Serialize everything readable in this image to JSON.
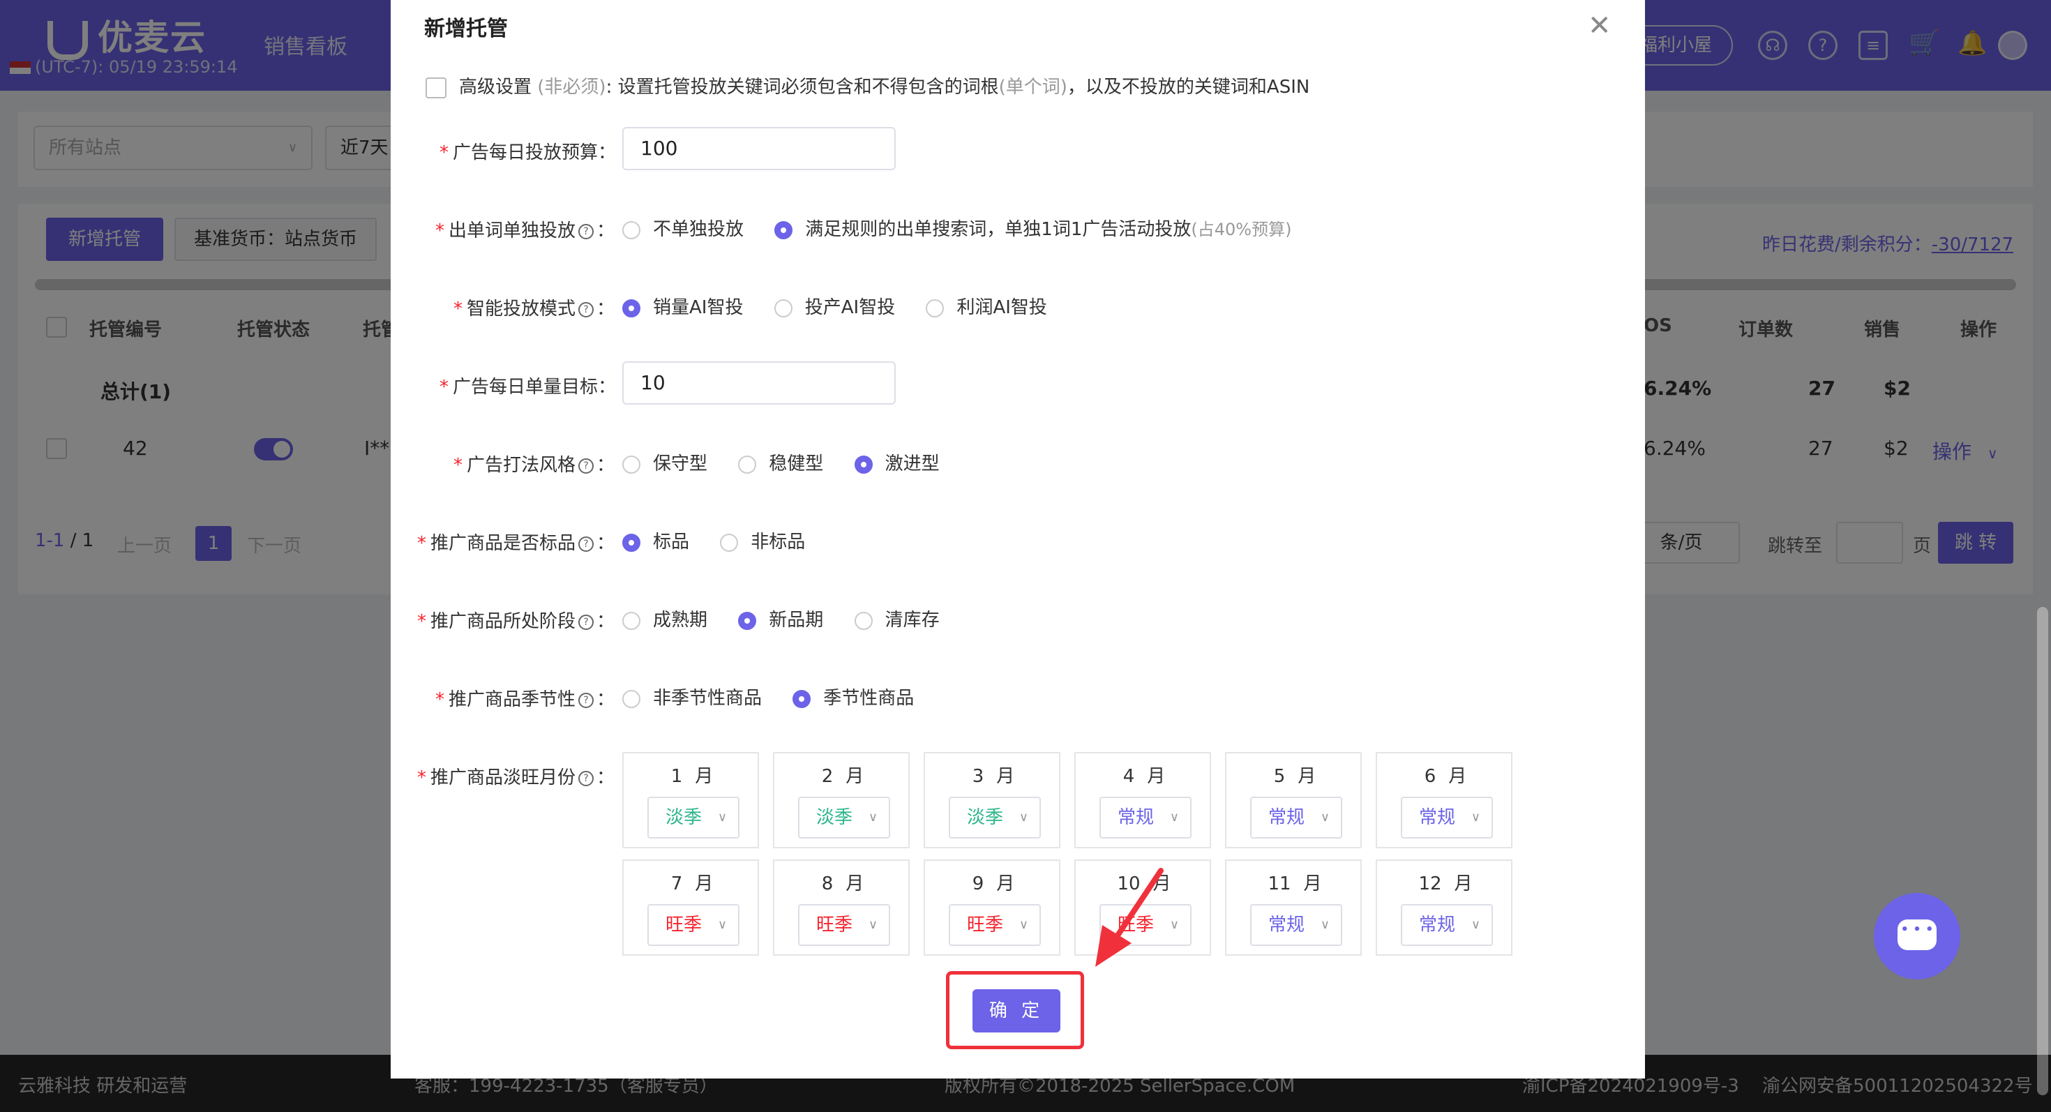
{
  "app": {
    "logo": "优麦云",
    "clock": "(UTC-7): 05/19 23:59:14",
    "nav_item": "销售看板",
    "welfare": "福利小屋"
  },
  "filters": {
    "site_placeholder": "所有站点",
    "date_range": "近7天"
  },
  "table": {
    "new_button": "新增托管",
    "currency_button": "基准货币：站点货币",
    "spend_info_label": "昨日花费/剩余积分：",
    "spend_info_value": "-30/7127",
    "headers": {
      "id": "托管编号",
      "status": "托管状态",
      "other": "托管",
      "acos": "OS",
      "orders": "订单数",
      "sales": "销售",
      "actions": "操作"
    },
    "total_row": {
      "label": "总计(1)",
      "acos": "6.24%",
      "orders": "27",
      "sales": "$2"
    },
    "rows": [
      {
        "id": "42",
        "name": "I**",
        "acos": "6.24%",
        "orders": "27",
        "sales": "$2",
        "action": "操作"
      }
    ],
    "pager": {
      "range": "1-1",
      "total": "/ 1",
      "prev": "上一页",
      "page": "1",
      "next": "下一页",
      "per_page": "条/页",
      "jump_to": "跳转至",
      "page_unit": "页",
      "go": "跳 转"
    }
  },
  "footer": {
    "company": "云雅科技 研发和运营",
    "service": "客服：199-4223-1735（客服专员）",
    "copyright": "版权所有©2018-2025 SellerSpace.COM",
    "icp": "渝ICP备2024021909号-3",
    "police": "渝公网安备50011202504322号"
  },
  "modal": {
    "title": "新增托管",
    "advanced": {
      "label": "高级设置",
      "optional": "(非必须)",
      "description": ": 设置托管投放关键词必须包含和不得包含的词根",
      "single_word": "(单个词)",
      "description2": "，以及不投放的关键词和ASIN"
    },
    "daily_budget": {
      "label": "广告每日投放预算",
      "value": "100"
    },
    "single_word_delivery": {
      "label": "出单词单独投放",
      "options": [
        "不单独投放",
        "满足规则的出单搜索词，单独1词1广告活动投放"
      ],
      "note": "(占40%预算)",
      "selected": 1
    },
    "ai_mode": {
      "label": "智能投放模式",
      "options": [
        "销量AI智投",
        "投产AI智投",
        "利润AI智投"
      ],
      "selected": 0
    },
    "daily_order_target": {
      "label": "广告每日单量目标",
      "value": "10"
    },
    "ad_style": {
      "label": "广告打法风格",
      "options": [
        "保守型",
        "稳健型",
        "激进型"
      ],
      "selected": 2
    },
    "standard_product": {
      "label": "推广商品是否标品",
      "options": [
        "标品",
        "非标品"
      ],
      "selected": 0
    },
    "product_stage": {
      "label": "推广商品所处阶段",
      "options": [
        "成熟期",
        "新品期",
        "清库存"
      ],
      "selected": 1
    },
    "seasonality": {
      "label": "推广商品季节性",
      "options": [
        "非季节性商品",
        "季节性商品"
      ],
      "selected": 1
    },
    "months": {
      "label": "推广商品淡旺月份",
      "unit": "月",
      "items": [
        {
          "month": "1",
          "season": "淡季",
          "kind": "low"
        },
        {
          "month": "2",
          "season": "淡季",
          "kind": "low"
        },
        {
          "month": "3",
          "season": "淡季",
          "kind": "low"
        },
        {
          "month": "4",
          "season": "常规",
          "kind": "normal"
        },
        {
          "month": "5",
          "season": "常规",
          "kind": "normal"
        },
        {
          "month": "6",
          "season": "常规",
          "kind": "normal"
        },
        {
          "month": "7",
          "season": "旺季",
          "kind": "peak"
        },
        {
          "month": "8",
          "season": "旺季",
          "kind": "peak"
        },
        {
          "month": "9",
          "season": "旺季",
          "kind": "peak"
        },
        {
          "month": "10",
          "season": "旺季",
          "kind": "peak"
        },
        {
          "month": "11",
          "season": "常规",
          "kind": "normal"
        },
        {
          "month": "12",
          "season": "常规",
          "kind": "normal"
        }
      ]
    },
    "confirm": "确 定"
  },
  "colors": {
    "accent": "#6c63e8",
    "low_season": "#2bb58a",
    "peak_season": "#f5222d",
    "highlight": "#f0313b"
  },
  "icons": [
    "logo-u-icon",
    "flag-icon",
    "headset-icon",
    "help-icon",
    "message-icon",
    "cart-icon",
    "bell-icon",
    "avatar-icon",
    "close-icon",
    "chevron-down-icon",
    "question-icon",
    "chat-icon",
    "arrow-annotation-icon"
  ]
}
